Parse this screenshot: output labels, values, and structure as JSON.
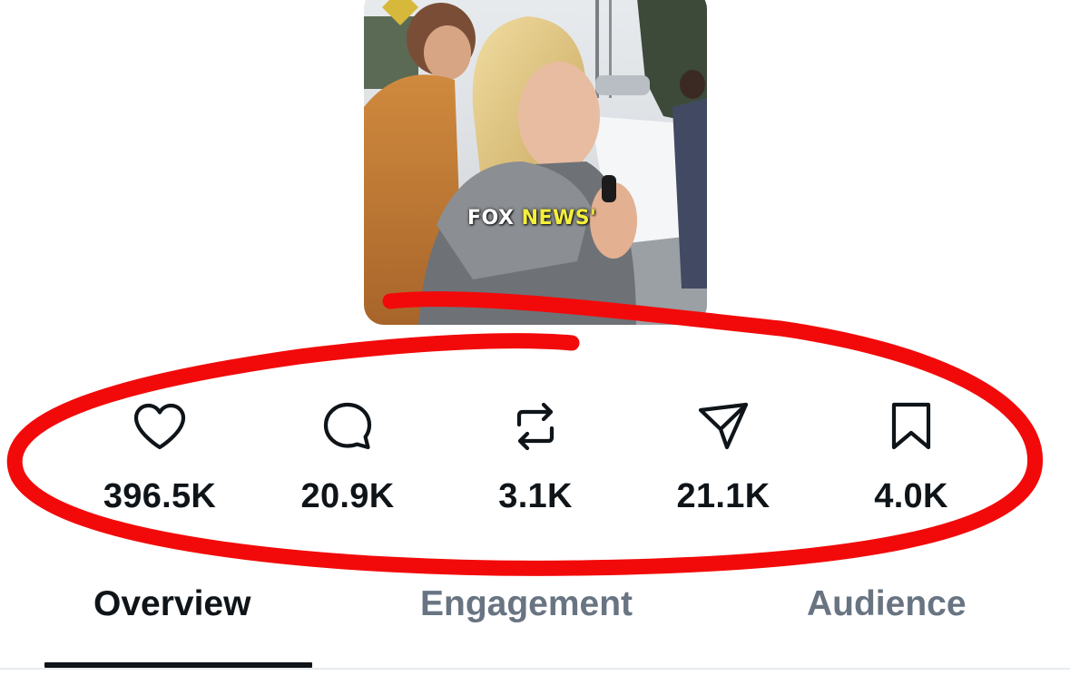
{
  "media": {
    "caption_white": "FOX",
    "caption_yellow": "NEWS'"
  },
  "metrics": {
    "likes": {
      "icon": "heart-icon",
      "value": "396.5K"
    },
    "replies": {
      "icon": "reply-bubble-icon",
      "value": "20.9K"
    },
    "reposts": {
      "icon": "repost-icon",
      "value": "3.1K"
    },
    "shares": {
      "icon": "share-send-icon",
      "value": "21.1K"
    },
    "bookmarks": {
      "icon": "bookmark-icon",
      "value": "4.0K"
    }
  },
  "tabs": [
    {
      "label": "Overview",
      "active": true
    },
    {
      "label": "Engagement",
      "active": false
    },
    {
      "label": "Audience",
      "active": false
    }
  ],
  "colors": {
    "text_primary": "#0f1419",
    "text_secondary": "#687482",
    "annotation_red": "#f20a0a",
    "caption_highlight": "#f4ef3a"
  }
}
